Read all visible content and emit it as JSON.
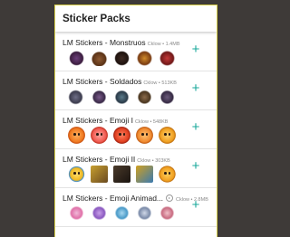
{
  "app": {
    "title": "Sticker Packs"
  },
  "colors": {
    "accent": "#17a79a",
    "frame_border": "#d8d04a",
    "background": "#3e3a38"
  },
  "packs": [
    {
      "name": "LM Stickers - Monstruos",
      "meta": "Cklow • 1.4MB",
      "add_label": "+",
      "animated": false,
      "stickers": [
        "monster-1",
        "monster-2",
        "monster-3",
        "monster-4",
        "monster-5"
      ]
    },
    {
      "name": "LM Stickers - Soldados",
      "meta": "Cklow • 513KB",
      "add_label": "+",
      "animated": false,
      "stickers": [
        "soldier-1",
        "soldier-2",
        "soldier-3",
        "soldier-4",
        "soldier-5"
      ]
    },
    {
      "name": "LM Stickers - Emoji I",
      "meta": "Cklow • 548KB",
      "add_label": "+",
      "animated": false,
      "stickers": [
        "emoji-1",
        "emoji-2",
        "emoji-3",
        "emoji-4",
        "emoji-5"
      ]
    },
    {
      "name": "LM Stickers - Emoji II",
      "meta": "Cklow • 303KB",
      "add_label": "+",
      "animated": false,
      "stickers": [
        "emoji-ii-1",
        "emoji-ii-2",
        "emoji-ii-3",
        "emoji-ii-4",
        "emoji-ii-5"
      ]
    },
    {
      "name": "LM Stickers - Emoji Animad...",
      "meta": "Cklow • 2.8MB",
      "add_label": "+",
      "animated": true,
      "stickers": [
        "anim-1",
        "anim-2",
        "anim-3",
        "anim-4",
        "anim-5"
      ]
    }
  ]
}
